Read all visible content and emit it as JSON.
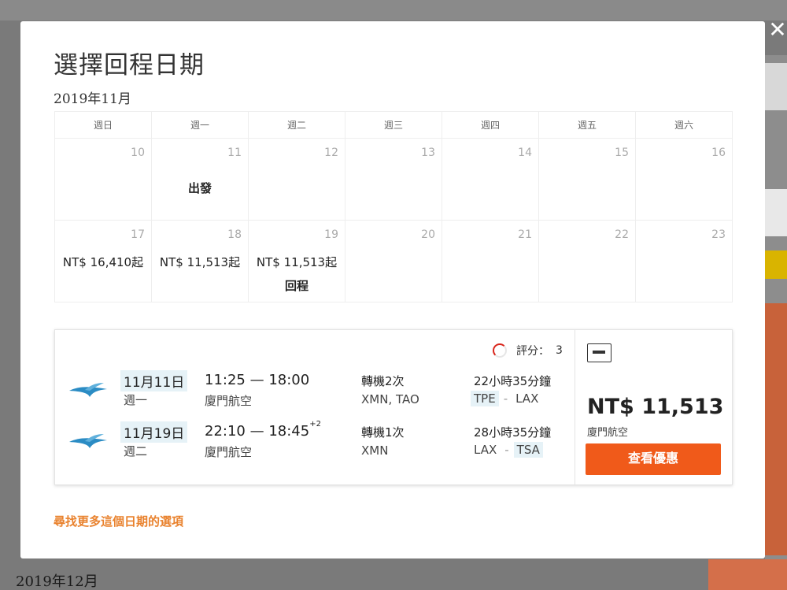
{
  "modal": {
    "title": "選擇回程日期",
    "month": "2019年11月",
    "close_label": "✕"
  },
  "calendar": {
    "weekdays": [
      "週日",
      "週一",
      "週二",
      "週三",
      "週四",
      "週五",
      "週六"
    ],
    "week1": [
      {
        "day": "10"
      },
      {
        "day": "11",
        "tag": "出發"
      },
      {
        "day": "12"
      },
      {
        "day": "13"
      },
      {
        "day": "14"
      },
      {
        "day": "15"
      },
      {
        "day": "16"
      }
    ],
    "week2": [
      {
        "day": "17",
        "price": "NT$ 16,410起"
      },
      {
        "day": "18",
        "price": "NT$ 11,513起"
      },
      {
        "day": "19",
        "price": "NT$ 11,513起",
        "tag": "回程"
      },
      {
        "day": "20"
      },
      {
        "day": "21"
      },
      {
        "day": "22"
      },
      {
        "day": "23"
      }
    ]
  },
  "flight": {
    "rating_label": "評分：",
    "rating_value": "3",
    "legs": [
      {
        "date": "11月11日",
        "weekday": "週一",
        "times": "11:25 — 18:00",
        "day_offset": "",
        "airline": "廈門航空",
        "stops": "轉機2次",
        "via": "XMN, TAO",
        "duration": "22小時35分鐘",
        "from": "TPE",
        "to": "LAX"
      },
      {
        "date": "11月19日",
        "weekday": "週二",
        "times": "22:10 — 18:45",
        "day_offset": "+2",
        "airline": "廈門航空",
        "stops": "轉機1次",
        "via": "XMN",
        "duration": "28小時35分鐘",
        "from": "LAX",
        "to": "TSA"
      }
    ],
    "route_separator": "-",
    "price": "NT$ 11,513",
    "price_airline": "廈門航空",
    "deal_button": "查看優惠"
  },
  "more_link": "尋找更多這個日期的選項",
  "background": {
    "next_month": "2019年12月"
  },
  "colors": {
    "accent_orange": "#f05a1a",
    "link_orange": "#e9822e",
    "highlight_blue": "#e6f2f7",
    "airline_blue": "#2b8cc4"
  }
}
